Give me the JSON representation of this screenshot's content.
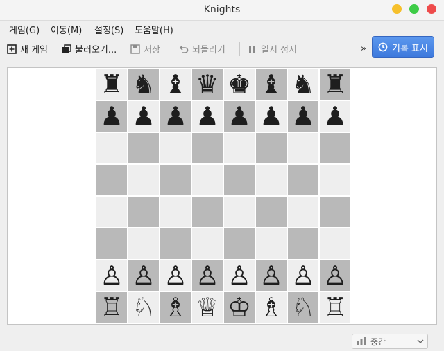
{
  "window": {
    "title": "Knights"
  },
  "menu": [
    "게임(G)",
    "이동(M)",
    "설정(S)",
    "도움말(H)"
  ],
  "toolbar": {
    "new_game": "새 게임",
    "load": "불러오기...",
    "save": "저장",
    "undo": "되돌리기",
    "pause": "일시 정지",
    "more": "»",
    "history": "기록 표시"
  },
  "board": {
    "rows": [
      [
        "♜",
        "♞",
        "♝",
        "♛",
        "♚",
        "♝",
        "♞",
        "♜"
      ],
      [
        "♟",
        "♟",
        "♟",
        "♟",
        "♟",
        "♟",
        "♟",
        "♟"
      ],
      [
        "",
        "",
        "",
        "",
        "",
        "",
        "",
        ""
      ],
      [
        "",
        "",
        "",
        "",
        "",
        "",
        "",
        ""
      ],
      [
        "",
        "",
        "",
        "",
        "",
        "",
        "",
        ""
      ],
      [
        "",
        "",
        "",
        "",
        "",
        "",
        "",
        ""
      ],
      [
        "♙",
        "♙",
        "♙",
        "♙",
        "♙",
        "♙",
        "♙",
        "♙"
      ],
      [
        "♖",
        "♘",
        "♗",
        "♕",
        "♔",
        "♗",
        "♘",
        "♖"
      ]
    ]
  },
  "status": {
    "difficulty": "중간"
  },
  "colors": {
    "accent": "#3c78dc",
    "dark_square": "#b9b9b9",
    "light_square": "#eeeeee"
  }
}
